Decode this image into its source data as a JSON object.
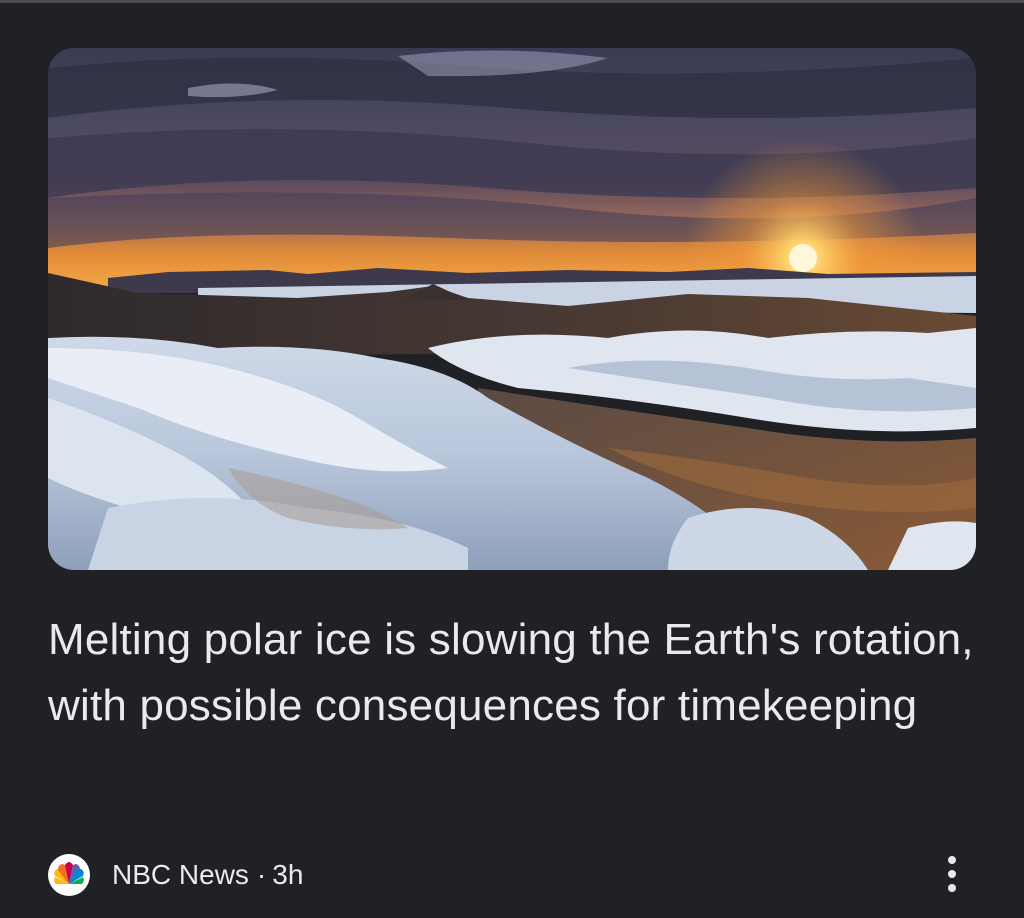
{
  "article": {
    "headline": "Melting polar ice is slowing the Earth's rotation, with possible consequences for timekeeping",
    "source": "NBC News",
    "separator": "·",
    "age": "3h",
    "image_icon": "photo-icon",
    "source_logo_icon": "nbc-peacock-logo-icon",
    "menu_icon": "more-vert-icon"
  },
  "colors": {
    "background": "#202124",
    "text": "#e8eaed"
  }
}
